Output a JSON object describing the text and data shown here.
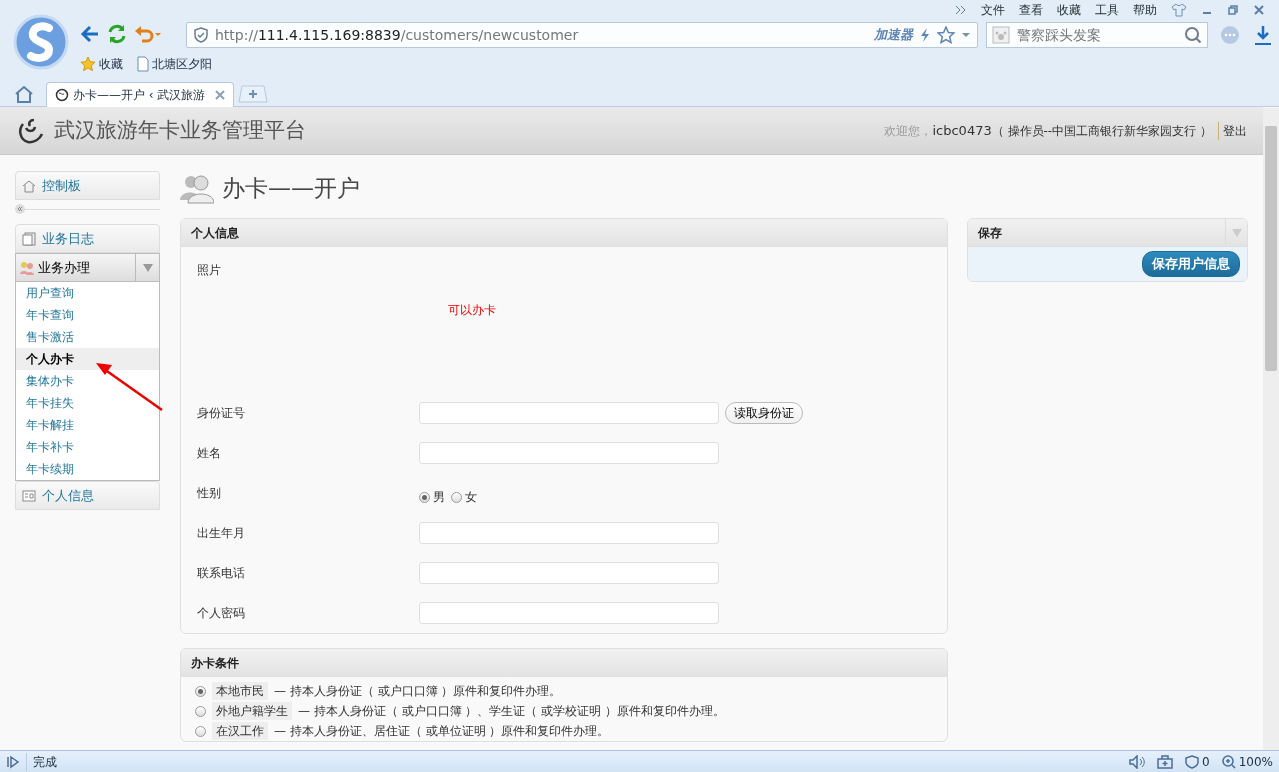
{
  "browser": {
    "menu": [
      "文件",
      "查看",
      "收藏",
      "工具",
      "帮助"
    ],
    "address": {
      "scheme": "http://",
      "host": "111.4.115.169:8839",
      "path": "/customers/newcustomer"
    },
    "accelerator": "加速器",
    "search": {
      "placeholder": "警察踩头发案"
    },
    "bookmarks": [
      "收藏",
      "北塘区夕阳"
    ],
    "tabs": [
      {
        "title": "办卡——开户 ‹ 武汉旅游",
        "selected": true
      }
    ]
  },
  "app": {
    "title": "武汉旅游年卡业务管理平台",
    "welcome": {
      "greeting": "欢迎您，",
      "user": "icbc0473",
      "role": "（ 操作员--中国工商银行新华家园支行 ）",
      "logout": "登出"
    }
  },
  "sidebar": {
    "items": [
      {
        "label": "控制板",
        "kind": "home"
      },
      {
        "label": "业务日志",
        "kind": "log"
      },
      {
        "label": "业务办理",
        "kind": "group",
        "expanded": true,
        "children": [
          {
            "label": "用户查询",
            "selected": false
          },
          {
            "label": "年卡查询",
            "selected": false
          },
          {
            "label": "售卡激活",
            "selected": false
          },
          {
            "label": "个人办卡",
            "selected": true
          },
          {
            "label": "集体办卡",
            "selected": false
          },
          {
            "label": "年卡挂失",
            "selected": false
          },
          {
            "label": "年卡解挂",
            "selected": false
          },
          {
            "label": "年卡补卡",
            "selected": false
          },
          {
            "label": "年卡续期",
            "selected": false
          }
        ]
      },
      {
        "label": "个人信息",
        "kind": "info"
      }
    ]
  },
  "page_title": "办卡——开户",
  "personal": {
    "title": "个人信息",
    "photo_label": "照片",
    "status": "可以办卡",
    "fields": [
      {
        "label": "身份证号",
        "kind": "text",
        "button": "读取身份证"
      },
      {
        "label": "姓名",
        "kind": "text"
      },
      {
        "label": "性别",
        "kind": "radio",
        "options": [
          {
            "label": "男",
            "selected": true
          },
          {
            "label": "女",
            "selected": false
          }
        ]
      },
      {
        "label": "出生年月",
        "kind": "text"
      },
      {
        "label": "联系电话",
        "kind": "text"
      },
      {
        "label": "个人密码",
        "kind": "text"
      }
    ]
  },
  "conditions": {
    "title": "办卡条件",
    "options": [
      {
        "tag": "本地市民",
        "text": "— 持本人身份证（ 或户口口簿 ）原件和复印件办理。",
        "selected": true
      },
      {
        "tag": "外地户籍学生",
        "text": "— 持本人身份证（ 或户口口簿 ）、学生证（ 或学校证明 ）原件和复印件办理。",
        "selected": false
      },
      {
        "tag": "在汉工作",
        "text": "— 持本人身份证、居住证（ 或单位证明 ）原件和复印件办理。",
        "selected": false
      }
    ]
  },
  "save": {
    "title": "保存",
    "button": "保存用户信息"
  },
  "status_bar": {
    "status": "完成",
    "ad_count": "0",
    "zoom": "100%"
  }
}
